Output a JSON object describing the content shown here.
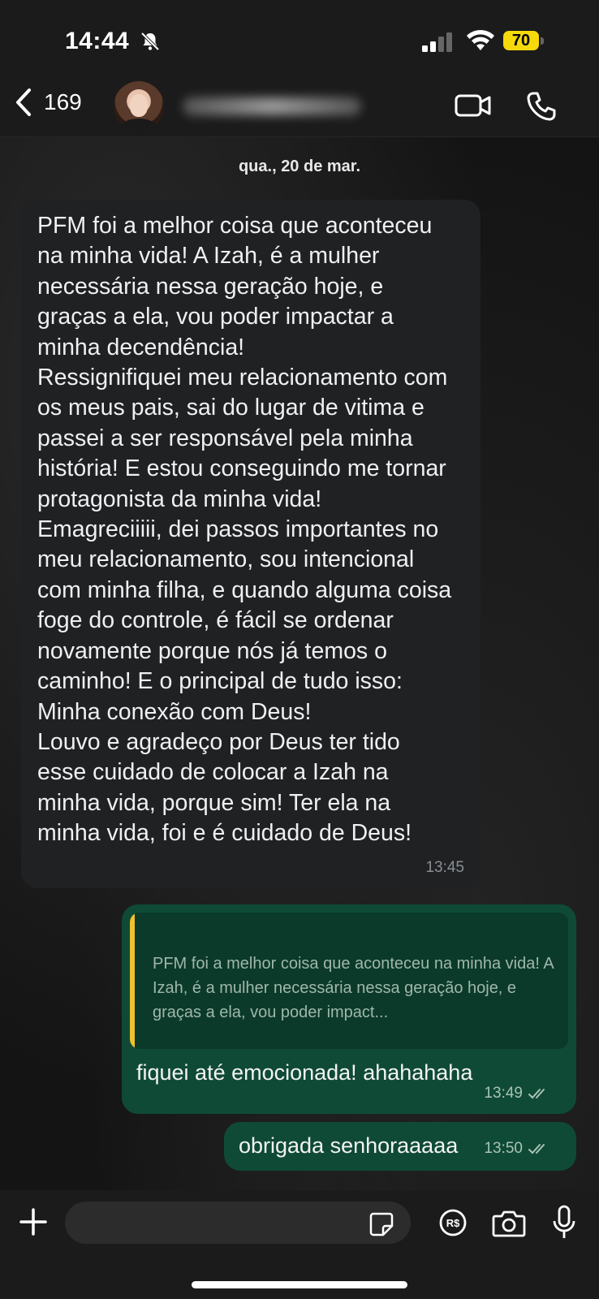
{
  "status_bar": {
    "time": "14:44",
    "battery": "70"
  },
  "header": {
    "unread_count": "169"
  },
  "date_label": "qua., 20 de mar.",
  "incoming": {
    "text": "PFM foi a melhor coisa que aconteceu\nna minha vida! A Izah, é a mulher\nnecessária nessa geração hoje, e\ngraças a ela, vou poder impactar a\nminha decendência!\nRessignifiquei meu relacionamento com\nos meus pais, sai do lugar de vitima e\npassei a ser responsável pela minha\nhistória! E estou conseguindo me tornar\nprotagonista da minha vida!\nEmagreciiiii, dei passos importantes no\nmeu relacionamento, sou intencional\ncom minha filha, e quando alguma coisa\nfoge do controle, é fácil se ordenar\nnovamente porque nós já temos o\ncaminho! E o principal de tudo isso:\nMinha conexão com Deus!\nLouvo e agradeço por Deus ter tido\nesse cuidado de colocar a Izah na\nminha vida, porque sim! Ter ela na\nminha vida, foi e é cuidado de Deus!",
    "time": "13:45"
  },
  "outgoing": [
    {
      "quote": "PFM foi a melhor coisa que aconteceu na minha vida! A Izah, é a mulher necessária nessa geração hoje, e graças a ela, vou poder impact...",
      "text": "fiquei até emocionada! ahahahaha",
      "time": "13:49"
    },
    {
      "text": "obrigada senhoraaaaa",
      "time": "13:50"
    }
  ],
  "input": {
    "placeholder": ""
  },
  "colors": {
    "incoming_bubble": "#1f2123",
    "outgoing_bubble": "#0f4a36",
    "quote_bar": "#f2c02c",
    "battery": "#f5d90a"
  }
}
